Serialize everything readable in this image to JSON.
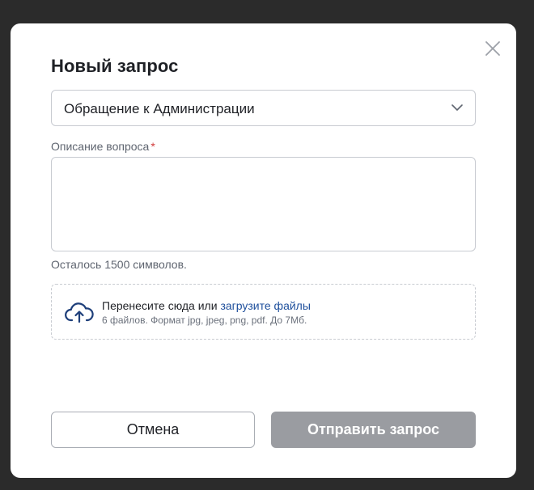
{
  "modal": {
    "title": "Новый запрос",
    "select": {
      "value": "Обращение к Администрации"
    },
    "description": {
      "label": "Описание вопроса",
      "required_mark": "*",
      "value": "",
      "chars_left": "Осталось 1500 символов."
    },
    "upload": {
      "text": "Перенесите сюда или",
      "link": "загрузите файлы",
      "hint": "6 файлов. Формат jpg, jpeg, png, pdf. До 7Мб."
    },
    "buttons": {
      "cancel": "Отмена",
      "submit": "Отправить запрос"
    }
  },
  "icons": {
    "close": "close-icon",
    "chevron": "chevron-down-icon",
    "upload": "cloud-upload-icon"
  },
  "colors": {
    "link": "#1e4f9c",
    "required": "#d23b3b",
    "submit_disabled": "#9a9ca1",
    "backdrop": "#2b2b2b"
  }
}
